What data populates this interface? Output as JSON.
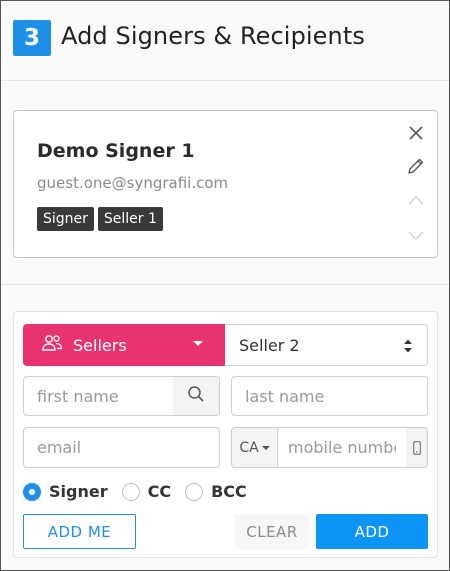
{
  "step": {
    "number": "3",
    "title": "Add Signers & Recipients"
  },
  "signers": [
    {
      "name": "Demo Signer 1",
      "email": "guest.one@syngrafii.com",
      "tags": [
        "Signer",
        "Seller 1"
      ]
    }
  ],
  "form": {
    "group": {
      "label": "Sellers",
      "icon": "users-icon",
      "color": "#e8336f"
    },
    "role_select": {
      "value": "Seller 2"
    },
    "first_name": {
      "placeholder": "first name",
      "value": ""
    },
    "last_name": {
      "placeholder": "last name",
      "value": ""
    },
    "email": {
      "placeholder": "email",
      "value": ""
    },
    "country_code": "CA",
    "mobile": {
      "placeholder": "mobile number",
      "value": ""
    },
    "recipient_types": [
      {
        "label": "Signer",
        "checked": true
      },
      {
        "label": "CC",
        "checked": false
      },
      {
        "label": "BCC",
        "checked": false
      }
    ],
    "buttons": {
      "add_me": "ADD ME",
      "clear": "CLEAR",
      "add": "ADD"
    }
  },
  "colors": {
    "accent": "#1e90e8",
    "group_pink": "#e8336f",
    "tag_dark": "#3a3a3a"
  }
}
